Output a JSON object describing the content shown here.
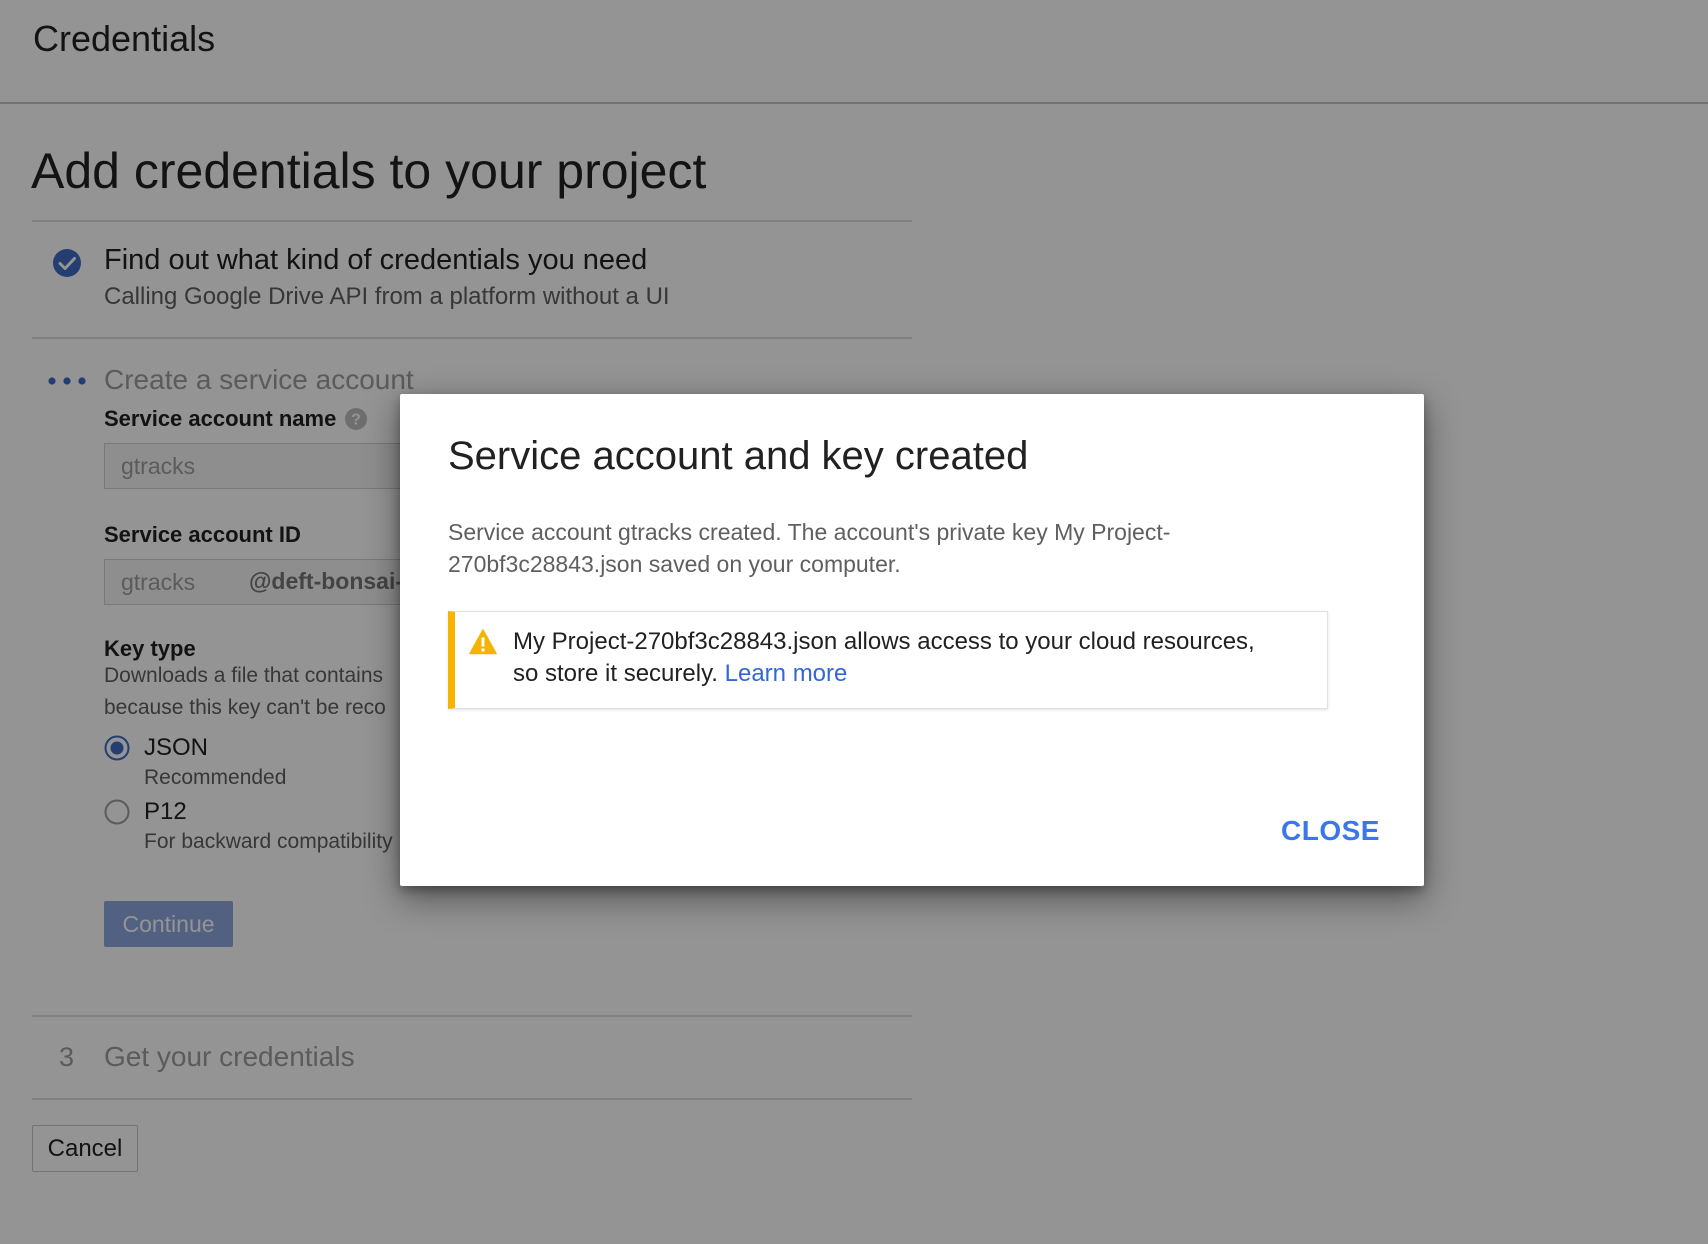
{
  "header": {
    "title": "Credentials"
  },
  "main": {
    "page_title": "Add credentials to your project",
    "step1": {
      "title": "Find out what kind of credentials you need",
      "subtitle": "Calling Google Drive API from a platform without a UI",
      "icon": "check-circle-icon",
      "color": "#3f6bc4"
    },
    "step2": {
      "title": "Create a service account",
      "icon": "progress-dots-icon",
      "service_account_name_label": "Service account name",
      "service_account_name_value": "gtracks",
      "service_account_id_label": "Service account ID",
      "service_account_id_value": "gtracks",
      "service_account_id_suffix": "@deft-bonsai-",
      "key_type_label": "Key type",
      "key_type_desc_line1": "Downloads a file that contains",
      "key_type_desc_line2": "because this key can't be reco",
      "options": [
        {
          "label": "JSON",
          "sub": "Recommended",
          "selected": true
        },
        {
          "label": "P12",
          "sub": "For backward compatibility",
          "selected": false
        }
      ],
      "continue_label": "Continue"
    },
    "step3": {
      "number": "3",
      "title": "Get your credentials"
    },
    "cancel_label": "Cancel"
  },
  "dialog": {
    "title": "Service account and key created",
    "body_line1": "Service account gtracks created. The account's private key My Project-",
    "body_line2": "270bf3c28843.json saved on your computer.",
    "warning": {
      "icon": "warning-icon",
      "text_line1": "My Project-270bf3c28843.json allows access to your cloud resources,",
      "text_line2": "so store it securely.",
      "link": "Learn more",
      "accent_color": "#f4b400"
    },
    "close_label": "CLOSE",
    "link_color": "#3b78e7"
  }
}
